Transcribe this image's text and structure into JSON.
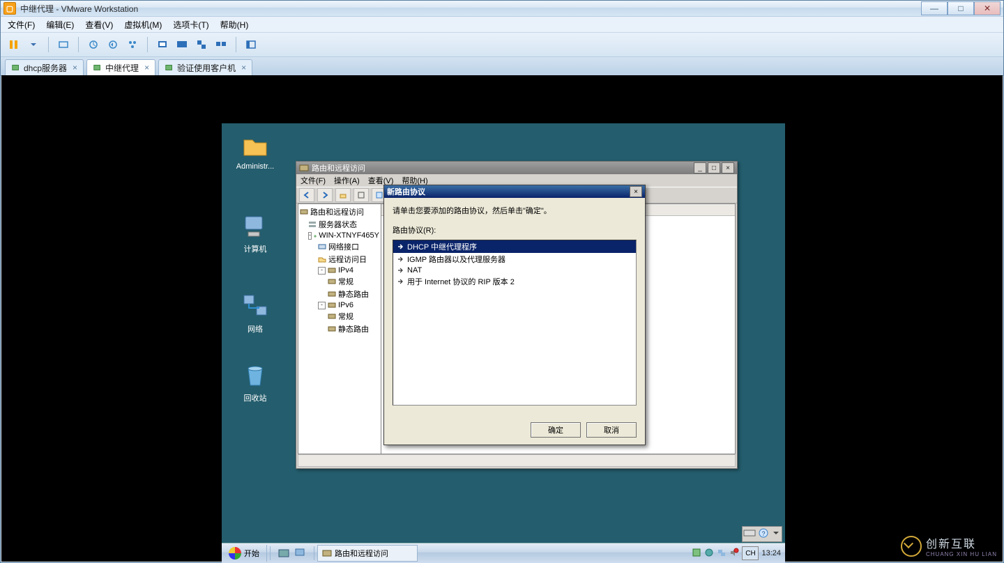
{
  "vmware": {
    "title": "中继代理 - VMware Workstation",
    "menu": [
      "文件(F)",
      "编辑(E)",
      "查看(V)",
      "虚拟机(M)",
      "选项卡(T)",
      "帮助(H)"
    ],
    "tabs": [
      {
        "label": "dhcp服务器",
        "active": false
      },
      {
        "label": "中继代理",
        "active": true
      },
      {
        "label": "验证使用客户机",
        "active": false
      }
    ],
    "controls": {
      "min": "—",
      "max": "□",
      "close": "✕"
    }
  },
  "desktop": {
    "icons": [
      {
        "label": "Administr..."
      },
      {
        "label": "计算机"
      },
      {
        "label": "网络"
      },
      {
        "label": "回收站"
      }
    ]
  },
  "mmc": {
    "title": "路由和远程访问",
    "menu": [
      "文件(F)",
      "操作(A)",
      "查看(V)",
      "帮助(H)"
    ],
    "tree": {
      "root": "路由和远程访问",
      "status": "服务器状态",
      "server": "WIN-XTNYF465Y",
      "netif": "网络接口",
      "remlog": "远程访问日",
      "ipv4": "IPv4",
      "ipv4_general": "常规",
      "ipv4_static": "静态路由",
      "ipv6": "IPv6",
      "ipv6_general": "常规",
      "ipv6_static": "静态路由"
    }
  },
  "dialog": {
    "title": "新路由协议",
    "instruction": "请单击您要添加的路由协议，然后单击\"确定\"。",
    "list_label": "路由协议(R):",
    "protocols": [
      {
        "label": "DHCP 中继代理程序",
        "selected": true
      },
      {
        "label": "IGMP 路由器以及代理服务器",
        "selected": false
      },
      {
        "label": "NAT",
        "selected": false
      },
      {
        "label": "用于 Internet 协议的 RIP 版本 2",
        "selected": false
      }
    ],
    "ok": "确定",
    "cancel": "取消"
  },
  "taskbar": {
    "start": "开始",
    "task": "路由和远程访问",
    "lang": "CH",
    "time": "13:24"
  },
  "watermark": {
    "t1": "创新互联",
    "t2": "CHUANG XIN HU LIAN"
  }
}
